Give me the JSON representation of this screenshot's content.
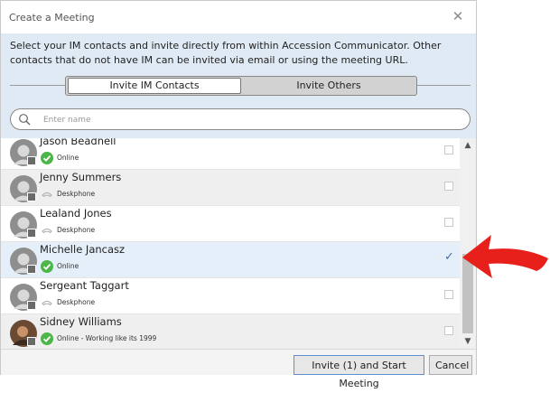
{
  "window": {
    "title": "Create a Meeting",
    "close_icon": "close-icon"
  },
  "description": "Select your IM contacts and invite directly from within Accession Communicator.  Other contacts that do not have IM can be invited via email or using the meeting URL.",
  "tabs": [
    {
      "label": "Invite IM Contacts",
      "active": true
    },
    {
      "label": "Invite Others",
      "active": false
    }
  ],
  "search": {
    "placeholder": "Enter name",
    "value": "",
    "icon": "search-icon"
  },
  "contacts": [
    {
      "name": "Jason Beadnell",
      "status": "Online",
      "status_icon": "online-check-icon",
      "checked": false
    },
    {
      "name": "Jenny Summers",
      "status": "Deskphone",
      "status_icon": "deskphone-icon",
      "checked": false
    },
    {
      "name": "Lealand Jones",
      "status": "Deskphone",
      "status_icon": "deskphone-icon",
      "checked": false
    },
    {
      "name": "Michelle Jancasz",
      "status": "Online",
      "status_icon": "online-check-icon",
      "checked": true
    },
    {
      "name": "Sergeant Taggart",
      "status": "Deskphone",
      "status_icon": "deskphone-icon",
      "checked": false
    },
    {
      "name": "Sidney Williams",
      "status": "Online - Working like its 1999",
      "status_icon": "online-check-icon",
      "checked": false
    }
  ],
  "buttons": {
    "invite": "Invite (1) and Start Meeting",
    "cancel": "Cancel"
  },
  "colors": {
    "online": "#4cb648",
    "accent": "#e8201b",
    "selected_row": "#e5effa",
    "panel": "#dfeaf5"
  }
}
